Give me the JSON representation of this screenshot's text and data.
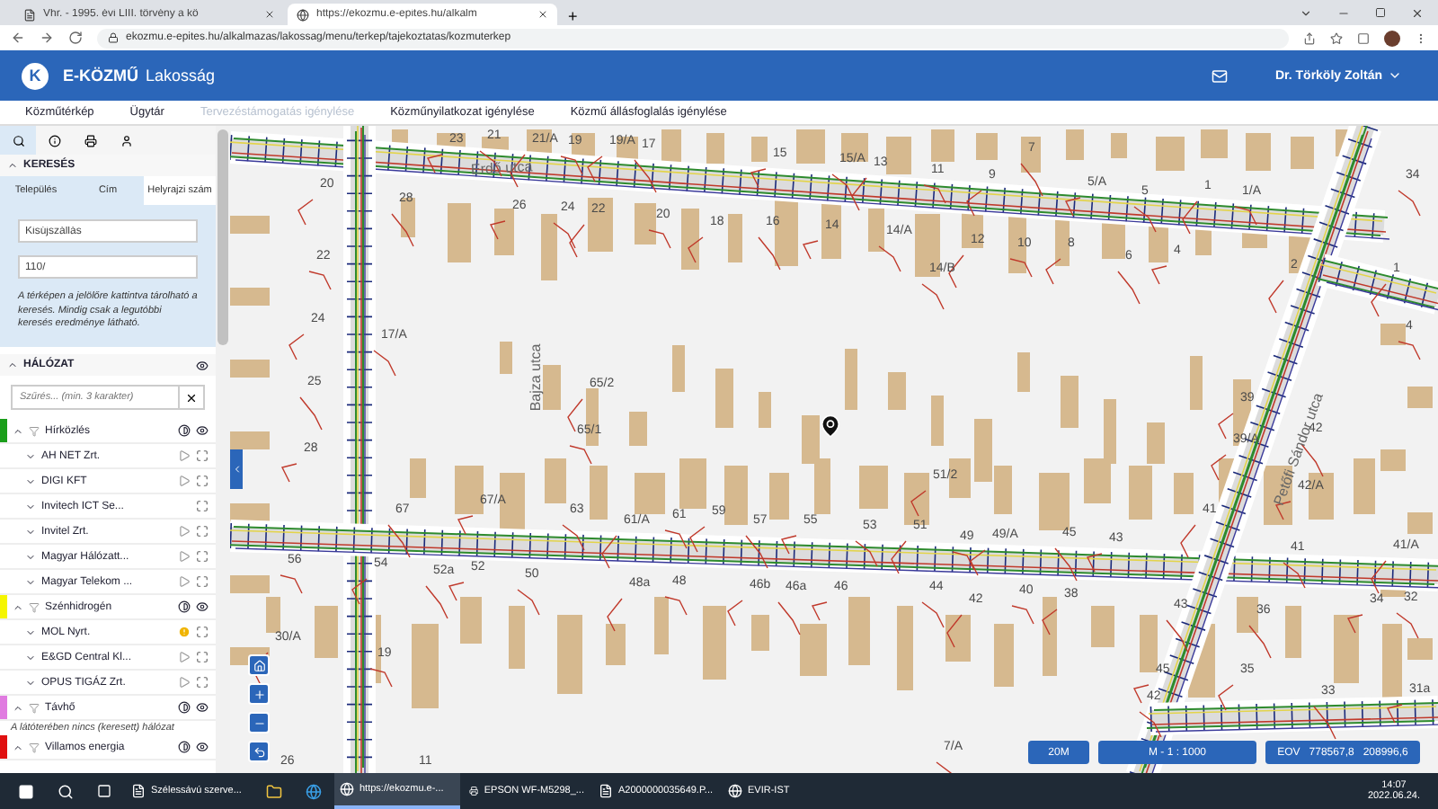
{
  "browser": {
    "tabs": [
      {
        "title": "Vhr. - 1995. évi LIII. törvény a kö",
        "selected": false
      },
      {
        "title": "https://ekozmu.e-epites.hu/alkalm",
        "selected": true
      }
    ],
    "new_tab": "+",
    "address": "ekozmu.e-epites.hu/alkalmazas/lakossag/menu/terkep/tajekoztatas/kozmuterkep"
  },
  "app": {
    "logo_letter": "K",
    "brand": "E-KÖZMŰ",
    "subtitle": "Lakosság",
    "user": "Dr. Törköly Zoltán"
  },
  "nav": [
    {
      "label": "Közműtérkép",
      "disabled": false
    },
    {
      "label": "Ügytár",
      "disabled": false
    },
    {
      "label": "Tervezéstámogatás igénylése",
      "disabled": true
    },
    {
      "label": "Közműnyilatkozat igénylése",
      "disabled": false
    },
    {
      "label": "Közmű állásfoglalás igénylése",
      "disabled": false
    }
  ],
  "sidebar": {
    "search": {
      "title": "KERESÉS",
      "expanded": true,
      "tabs": [
        {
          "label": "Település",
          "selected": false
        },
        {
          "label": "Cím",
          "selected": false
        },
        {
          "label": "Helyrajzi szám",
          "selected": true
        }
      ],
      "fields": [
        {
          "value": "Kisújszállás"
        },
        {
          "value": "110/"
        }
      ],
      "hint": "A térképen a jelölőre kattintva tárolható a keresés. Mindig csak a legutóbbi keresés eredménye látható."
    },
    "network": {
      "title": "HÁLÓZAT",
      "expanded": true,
      "filter_placeholder": "Szűrés... (min. 3 karakter)",
      "groups": [
        {
          "name": "Hírközlés",
          "color": "#1a9e1a",
          "expanded": true,
          "children": [
            {
              "name": "AH NET Zrt.",
              "kind": "layer"
            },
            {
              "name": "DIGI KFT",
              "kind": "layer"
            },
            {
              "name": "Invitech ICT Se...",
              "kind": "plain"
            },
            {
              "name": "Invitel Zrt.",
              "kind": "layer"
            },
            {
              "name": "Magyar Hálózatt...",
              "kind": "layer"
            },
            {
              "name": "Magyar Telekom ...",
              "kind": "layer"
            }
          ]
        },
        {
          "name": "Szénhidrogén",
          "color": "#f5f500",
          "expanded": true,
          "children": [
            {
              "name": "MOL Nyrt.",
              "kind": "warning"
            },
            {
              "name": "E&GD Central Kl...",
              "kind": "layer"
            },
            {
              "name": "OPUS TIGÁZ Zrt.",
              "kind": "layer"
            }
          ]
        },
        {
          "name": "Távhő",
          "color": "#e07be0",
          "expanded": true,
          "message": "A látóterében nincs (keresett) hálózat"
        },
        {
          "name": "Villamos energia",
          "color": "#e01010",
          "expanded": true
        }
      ]
    }
  },
  "map": {
    "streets": [
      "Erdő utca",
      "Bajza utca",
      "Petőfi Sándor utca"
    ],
    "labels": [
      "23",
      "21",
      "21/A",
      "19",
      "19/A",
      "17",
      "15",
      "15/A",
      "13",
      "11",
      "9",
      "7",
      "5/A",
      "5",
      "1",
      "1/A",
      "20",
      "28",
      "26",
      "24",
      "22",
      "20",
      "18",
      "16",
      "14",
      "14/A",
      "12",
      "10",
      "8",
      "6",
      "4",
      "14/B",
      "2",
      "22",
      "24",
      "25",
      "28",
      "17/A",
      "65/2",
      "65/1",
      "51/2",
      "67",
      "67/A",
      "63",
      "61/A",
      "61",
      "59",
      "57",
      "55",
      "53",
      "51",
      "49",
      "49/A",
      "45",
      "43",
      "41",
      "41/A",
      "56",
      "54",
      "52a",
      "52",
      "50",
      "48a",
      "48",
      "46b",
      "46a",
      "46",
      "44",
      "42",
      "40",
      "38",
      "36",
      "34",
      "32",
      "30/A",
      "19",
      "35",
      "33",
      "31a",
      "7/A",
      "26",
      "11",
      "39/A",
      "42",
      "42/A",
      "34",
      "1",
      "4",
      "39",
      "43",
      "45",
      "42",
      "41"
    ],
    "scale_bar": "20M",
    "scale": "M - 1 : 1000",
    "coordinates": "EOV   778567,8   208996,6"
  },
  "taskbar": {
    "apps": [
      {
        "label": "Szélessávú szerve...",
        "selected": false
      },
      {
        "label": "https://ekozmu.e-...",
        "selected": true
      },
      {
        "label": "EPSON WF-M5298_...",
        "selected": false
      },
      {
        "label": "A2000000035649.P...",
        "selected": false
      },
      {
        "label": "EVIR-IST",
        "selected": false
      }
    ],
    "time": "14:07",
    "date": "2022.06.24."
  }
}
